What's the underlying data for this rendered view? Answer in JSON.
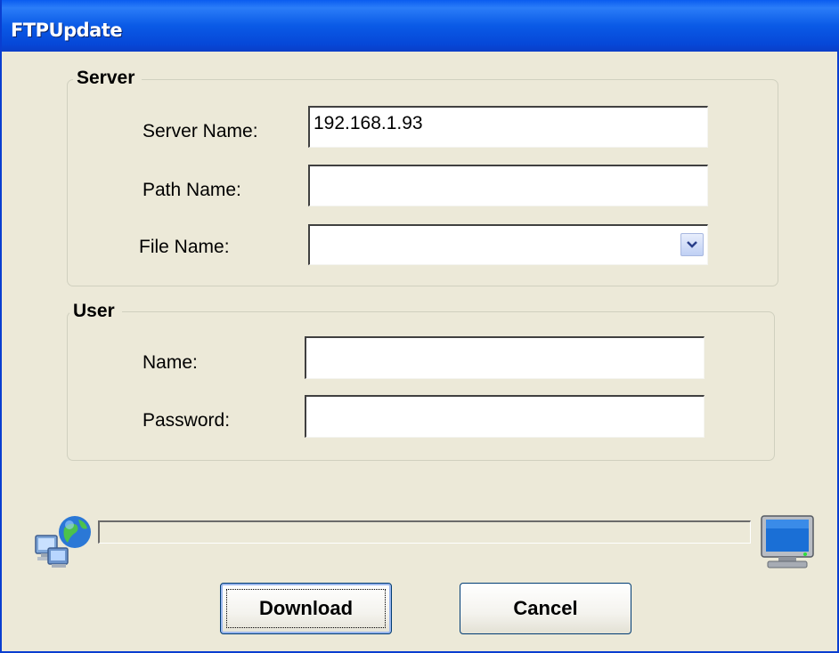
{
  "window": {
    "title": "FTPUpdate"
  },
  "server_group": {
    "legend": "Server",
    "server_name_label": "Server Name:",
    "server_name_value": "192.168.1.93",
    "path_name_label": "Path Name:",
    "path_name_value": "",
    "file_name_label": "File Name:",
    "file_name_value": ""
  },
  "user_group": {
    "legend": "User",
    "name_label": "Name:",
    "name_value": "",
    "password_label": "Password:",
    "password_value": ""
  },
  "progress": {
    "value": 0
  },
  "buttons": {
    "download_label": "Download",
    "cancel_label": "Cancel"
  },
  "icons": {
    "left": "network-globe-icon",
    "right": "computer-monitor-icon",
    "combo": "chevron-down-icon"
  },
  "colors": {
    "titlebar": "#0a5ae6",
    "window_bg": "#ece9d8",
    "button_border": "#003c74"
  }
}
